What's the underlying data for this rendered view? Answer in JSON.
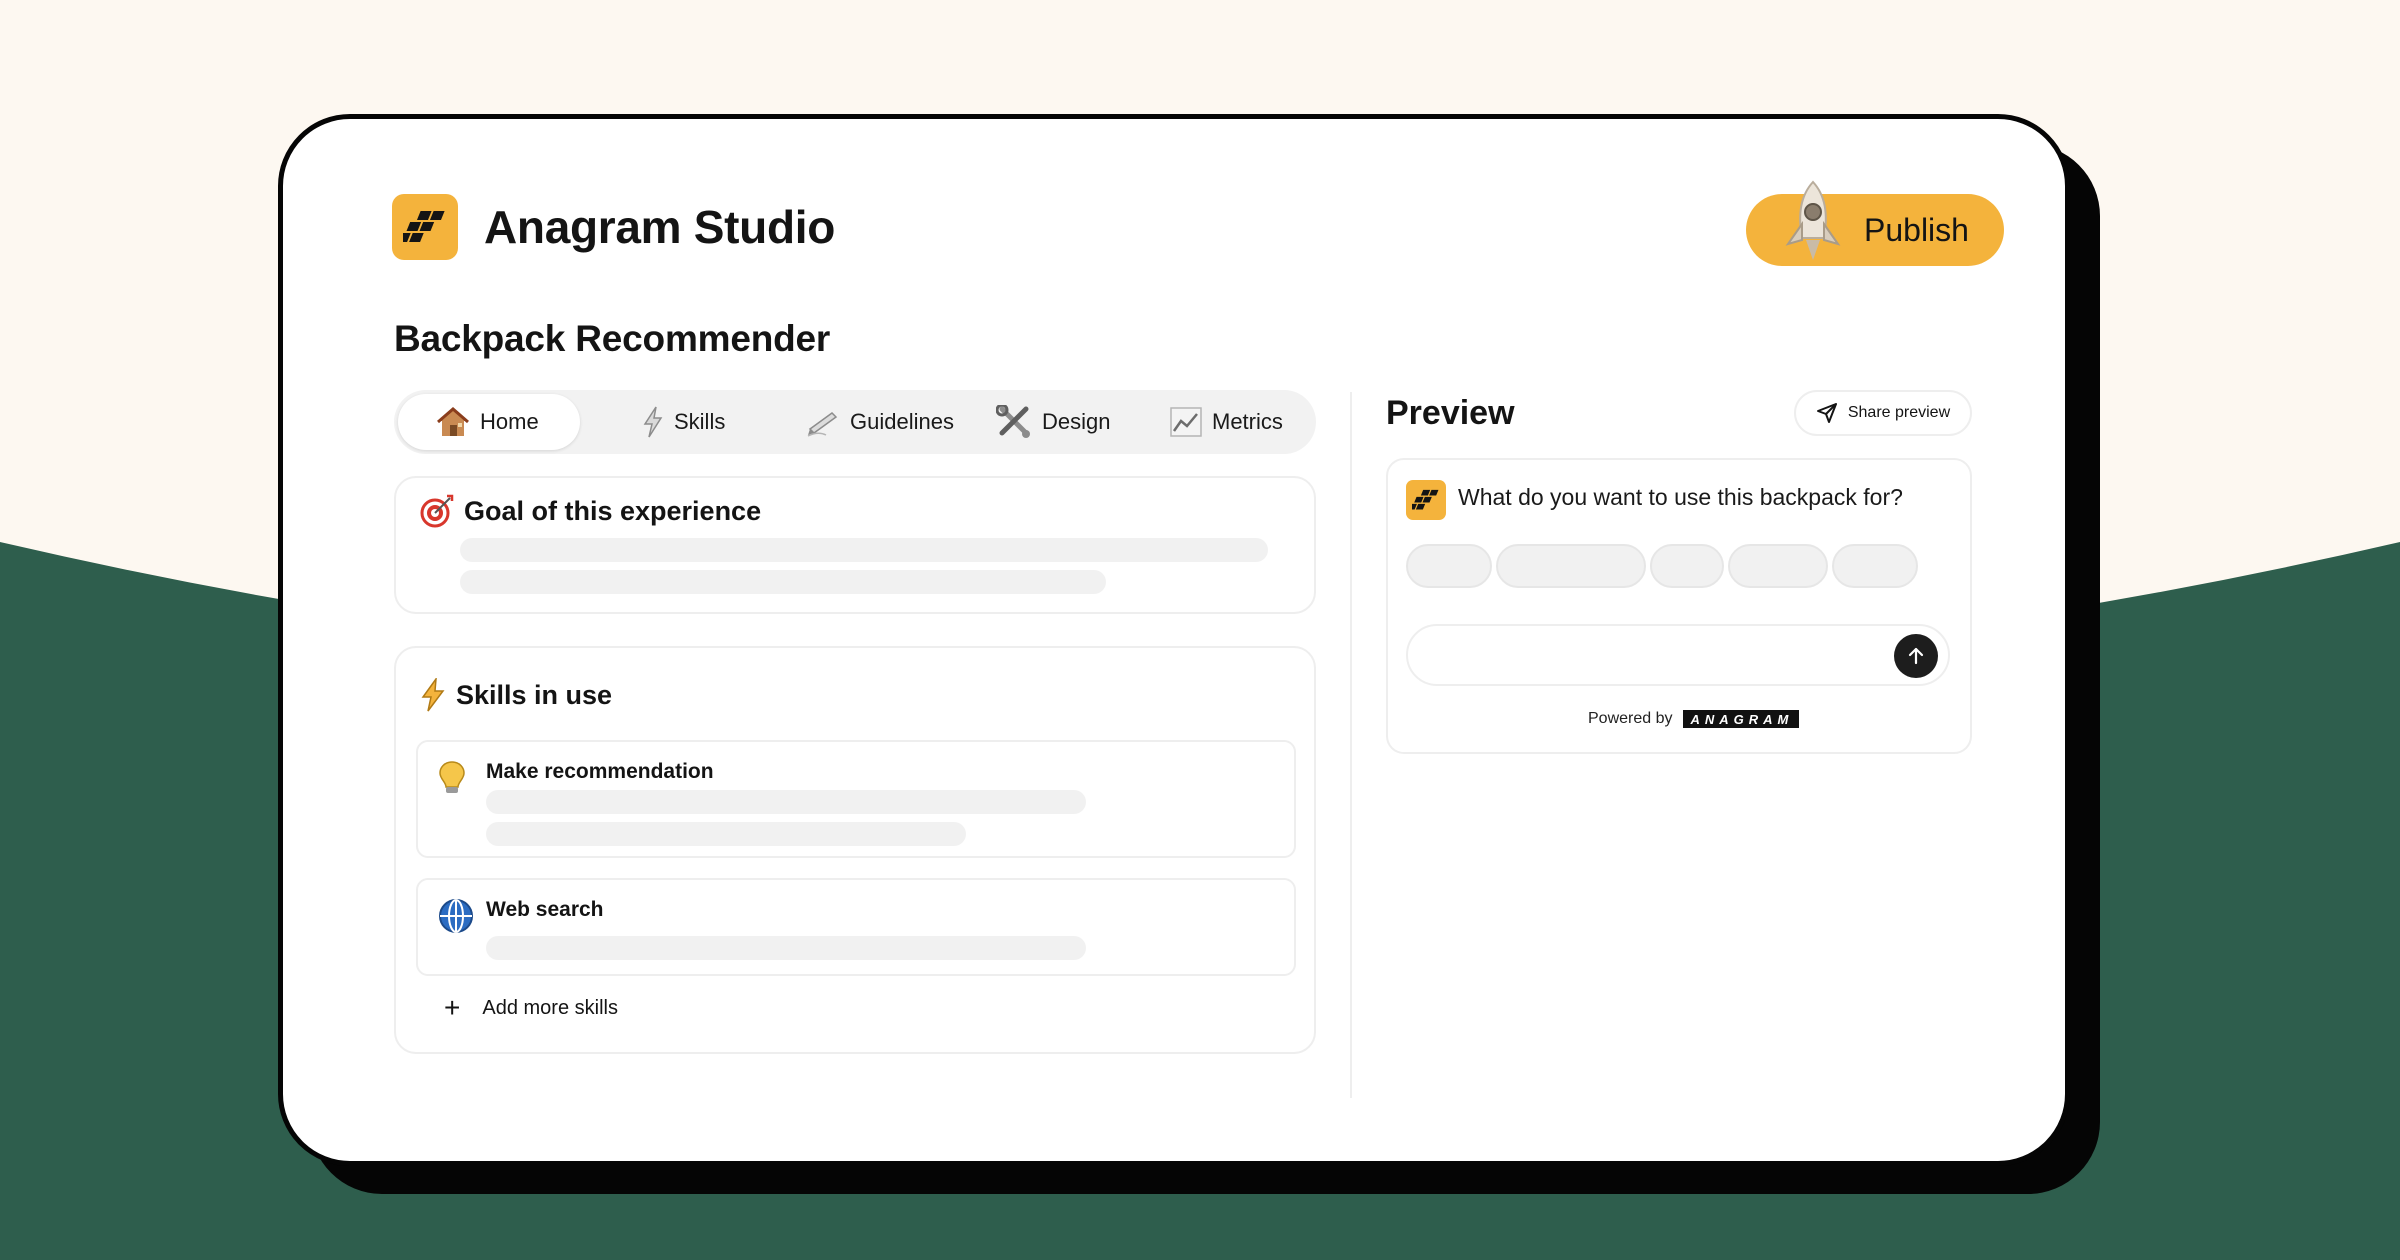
{
  "app": {
    "name": "Anagram Studio",
    "publish_label": "Publish"
  },
  "page": {
    "title": "Backpack Recommender"
  },
  "tabs": [
    {
      "label": "Home",
      "icon": "house-icon",
      "active": true
    },
    {
      "label": "Skills",
      "icon": "lightning-icon",
      "active": false
    },
    {
      "label": "Guidelines",
      "icon": "pen-icon",
      "active": false
    },
    {
      "label": "Design",
      "icon": "tools-icon",
      "active": false
    },
    {
      "label": "Metrics",
      "icon": "chart-icon",
      "active": false
    }
  ],
  "goal": {
    "title": "Goal of this experience",
    "icon": "target-icon"
  },
  "skills": {
    "title": "Skills in use",
    "icon": "lightning-icon",
    "items": [
      {
        "name": "Make recommendation",
        "icon": "lightbulb-icon"
      },
      {
        "name": "Web search",
        "icon": "globe-icon"
      }
    ],
    "add_label": "Add more skills"
  },
  "preview": {
    "title": "Preview",
    "share_label": "Share preview",
    "question": "What do you want to use this backpack for?",
    "powered_by": "Powered by",
    "wordmark": "ANAGRAM"
  },
  "colors": {
    "accent": "#f4b33c",
    "background_top": "#fdf8f1",
    "background_bottom": "#2e5e4d",
    "frame": "#050505"
  }
}
